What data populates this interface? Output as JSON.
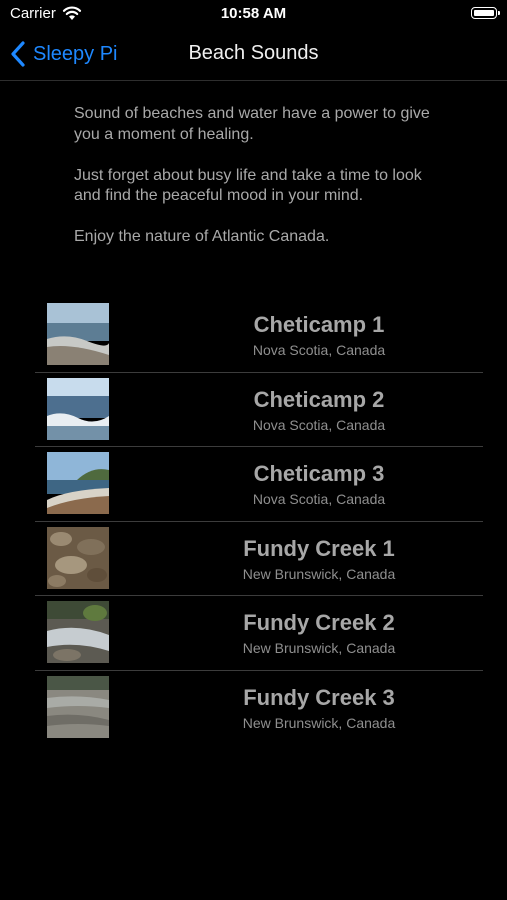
{
  "status": {
    "carrier": "Carrier",
    "time": "10:58 AM"
  },
  "nav": {
    "back_label": "Sleepy Pi",
    "title": "Beach Sounds"
  },
  "intro": [
    "Sound of beaches and water have a power to give you a moment of healing.",
    "Just forget about busy life and take a time to look and find the peaceful mood in your mind.",
    "Enjoy the nature of Atlantic Canada."
  ],
  "items": [
    {
      "title": "Cheticamp 1",
      "subtitle": "Nova Scotia, Canada"
    },
    {
      "title": "Cheticamp 2",
      "subtitle": "Nova Scotia, Canada"
    },
    {
      "title": "Cheticamp 3",
      "subtitle": "Nova Scotia, Canada"
    },
    {
      "title": "Fundy Creek 1",
      "subtitle": "New Brunswick, Canada"
    },
    {
      "title": "Fundy Creek 2",
      "subtitle": "New Brunswick, Canada"
    },
    {
      "title": "Fundy Creek 3",
      "subtitle": "New Brunswick, Canada"
    }
  ],
  "colors": {
    "accent": "#1e88ff",
    "background": "#000000"
  }
}
